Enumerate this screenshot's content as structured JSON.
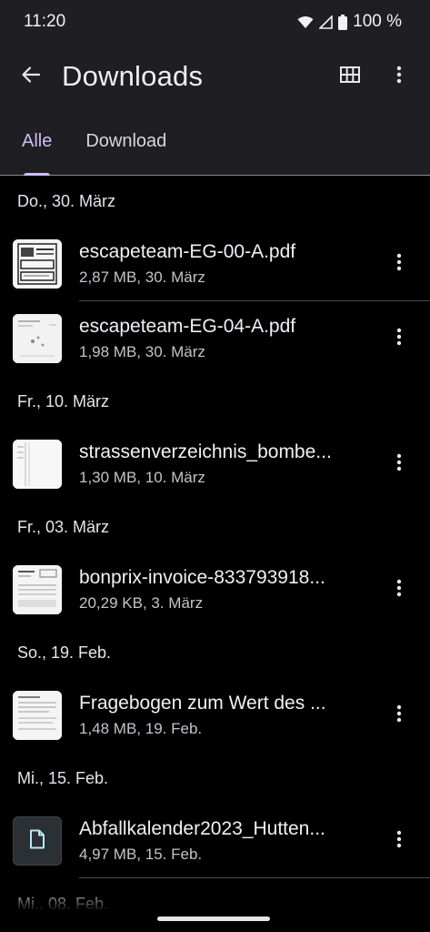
{
  "status_bar": {
    "time": "11:20",
    "battery": "100 %"
  },
  "app_bar": {
    "title": "Downloads"
  },
  "tabs": [
    {
      "label": "Alle",
      "selected": true
    },
    {
      "label": "Download",
      "selected": false
    }
  ],
  "sections": [
    {
      "header": "Do., 30. März",
      "files": [
        {
          "name": "escapeteam-EG-00-A.pdf",
          "meta": "2,87 MB, 30. März"
        },
        {
          "name": "escapeteam-EG-04-A.pdf",
          "meta": "1,98 MB, 30. März"
        }
      ]
    },
    {
      "header": "Fr., 10. März",
      "files": [
        {
          "name": "strassenverzeichnis_bombe...",
          "meta": "1,30 MB, 10. März"
        }
      ]
    },
    {
      "header": "Fr., 03. März",
      "files": [
        {
          "name": "bonprix-invoice-833793918...",
          "meta": "20,29 KB, 3. März"
        }
      ]
    },
    {
      "header": "So., 19. Feb.",
      "files": [
        {
          "name": "Fragebogen zum Wert des ...",
          "meta": "1,48 MB, 19. Feb."
        }
      ]
    },
    {
      "header": "Mi., 15. Feb.",
      "files": [
        {
          "name": "Abfallkalender2023_Hutten...",
          "meta": "4,97 MB, 15. Feb."
        }
      ]
    },
    {
      "header": "Mi., 08. Feb.",
      "files": []
    }
  ],
  "colors": {
    "accent": "#cdbdf3",
    "top_bar": "#1f1e22",
    "background": "#000000"
  }
}
